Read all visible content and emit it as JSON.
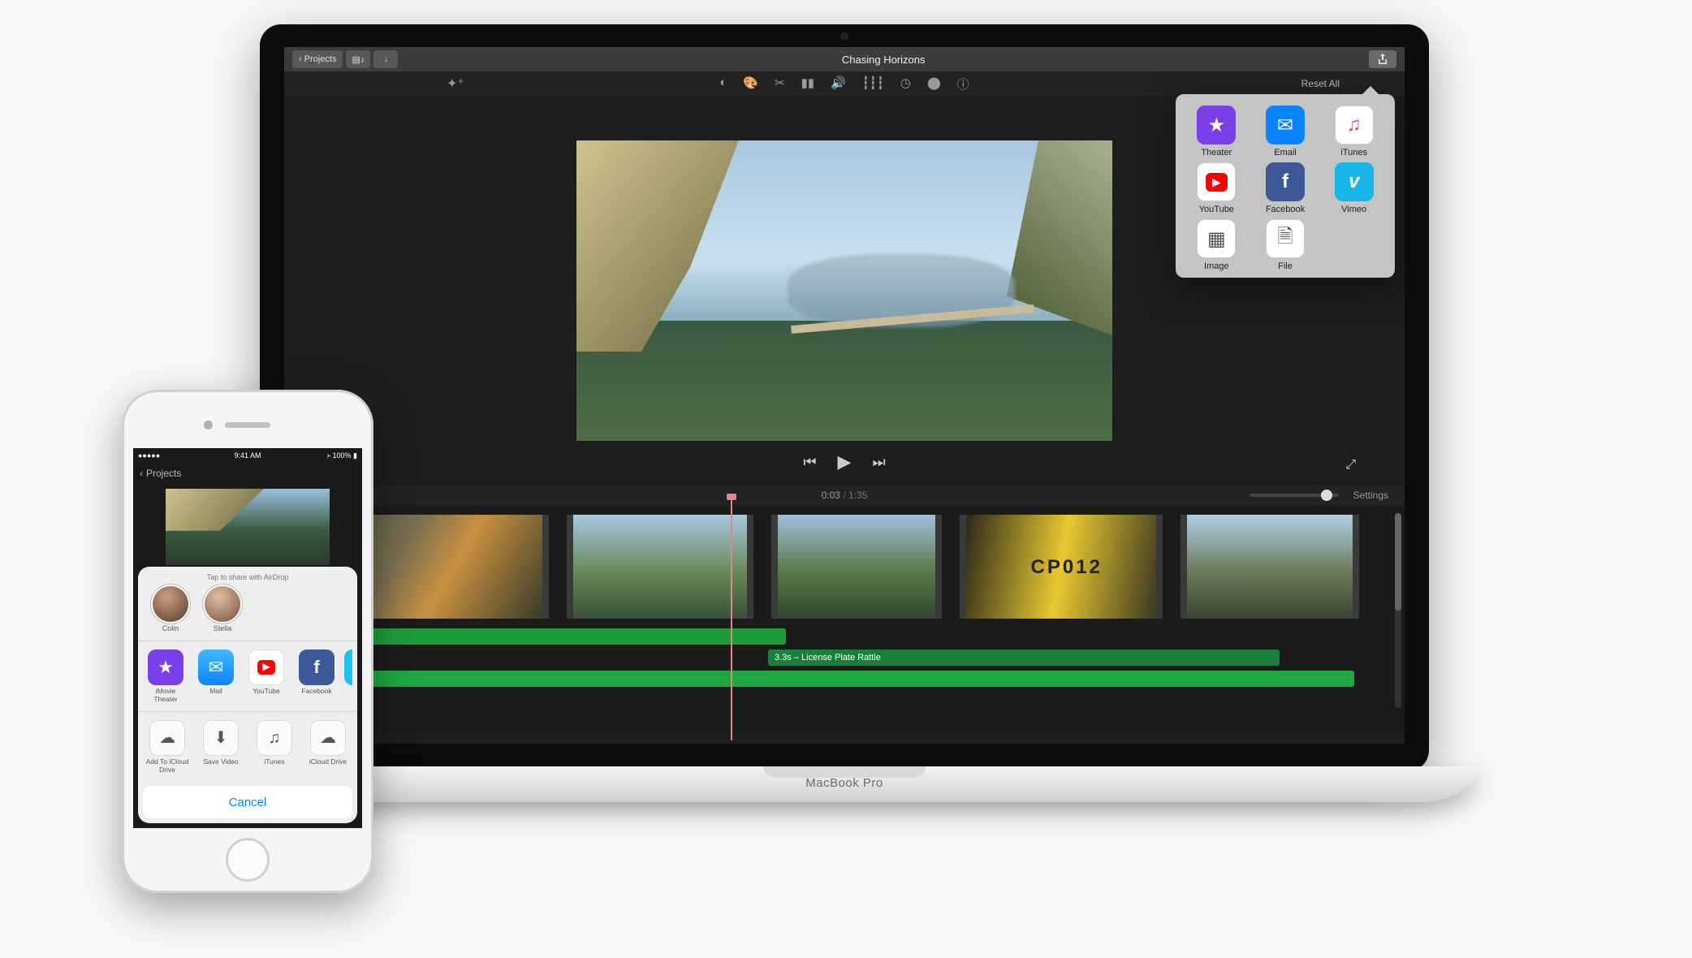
{
  "mac": {
    "device_label": "MacBook Pro",
    "titlebar": {
      "back_label": "Projects",
      "title": "Chasing Horizons"
    },
    "toolbar": {
      "reset_label": "Reset All"
    },
    "playback": {
      "current": "0:03",
      "duration": "1:35",
      "settings_label": "Settings"
    },
    "timeline": {
      "audio_clip_label": "3.3s – License Plate Rattle"
    },
    "share": [
      {
        "label": "Theater",
        "color": "#7a3fe8",
        "glyph": "★"
      },
      {
        "label": "Email",
        "color": "#0a84ff",
        "glyph": "✉"
      },
      {
        "label": "iTunes",
        "color": "#ffffff",
        "glyph": "♫"
      },
      {
        "label": "YouTube",
        "color": "#ff0000",
        "glyph": "▶"
      },
      {
        "label": "Facebook",
        "color": "#3b5998",
        "glyph": "f"
      },
      {
        "label": "Vimeo",
        "color": "#17b7ea",
        "glyph": "v"
      },
      {
        "label": "Image",
        "color": "#ffffff",
        "glyph": "▦"
      },
      {
        "label": "File",
        "color": "#ffffff",
        "glyph": "🗎"
      }
    ]
  },
  "iphone": {
    "status": {
      "carrier": "●●●●●",
      "time": "9:41 AM",
      "battery": "100%",
      "bt": "᚛"
    },
    "nav_back": "Projects",
    "sheet": {
      "airdrop_label": "Tap to share with AirDrop",
      "contacts": [
        {
          "name": "Colin"
        },
        {
          "name": "Stella"
        }
      ],
      "apps": [
        {
          "label": "iMovie Theater",
          "color": "#7a3fe8",
          "glyph": "★"
        },
        {
          "label": "Mail",
          "color": "#1e9bff",
          "glyph": "✉"
        },
        {
          "label": "YouTube",
          "color": "#ff0000",
          "glyph": "▶"
        },
        {
          "label": "Facebook",
          "color": "#3b5998",
          "glyph": "f"
        }
      ],
      "actions": [
        {
          "label": "Add To iCloud Drive",
          "glyph": "☁"
        },
        {
          "label": "Save Video",
          "glyph": "⬇"
        },
        {
          "label": "iTunes",
          "glyph": "♫"
        },
        {
          "label": "iCloud Drive",
          "glyph": "☁"
        }
      ],
      "cancel_label": "Cancel"
    }
  }
}
